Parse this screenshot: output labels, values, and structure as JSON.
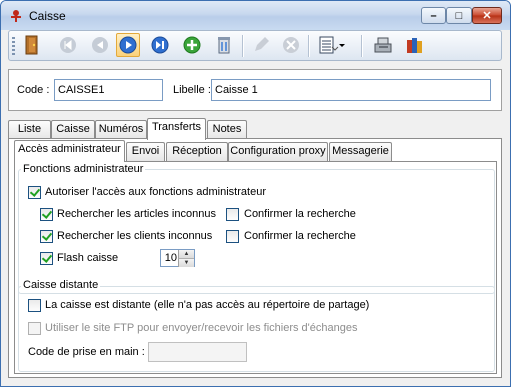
{
  "window": {
    "title": "Caisse"
  },
  "caption_buttons": {
    "minimize": "–",
    "maximize": "□",
    "close": "✕"
  },
  "toolbar": {
    "items": [
      {
        "name": "exit-icon",
        "enabled": true
      },
      {
        "name": "first-record-icon",
        "enabled": false
      },
      {
        "name": "previous-record-icon",
        "enabled": false
      },
      {
        "name": "next-record-icon",
        "enabled": true,
        "active": true
      },
      {
        "name": "last-record-icon",
        "enabled": true
      },
      {
        "name": "add-icon",
        "enabled": true
      },
      {
        "name": "delete-icon",
        "enabled": true
      },
      {
        "name": "edit-icon",
        "enabled": false
      },
      {
        "name": "cancel-icon",
        "enabled": false
      },
      {
        "name": "list-menu-icon",
        "enabled": true
      },
      {
        "name": "cash-register-icon",
        "enabled": true
      },
      {
        "name": "books-icon",
        "enabled": true
      }
    ]
  },
  "header": {
    "code_label": "Code :",
    "code_value": "CAISSE1",
    "libelle_label": "Libelle :",
    "libelle_value": "Caisse 1"
  },
  "main_tabs": [
    "Liste",
    "Caisse",
    "Numéros",
    "Transferts",
    "Notes"
  ],
  "main_tab_selected": "Transferts",
  "sub_tabs": [
    "Accès administrateur",
    "Envoi",
    "Réception",
    "Configuration proxy",
    "Messagerie"
  ],
  "sub_tab_selected": "Accès administrateur",
  "fonctions_admin": {
    "title": "Fonctions administrateur",
    "autoriser": {
      "label": "Autoriser l'accès aux fonctions administrateur",
      "checked": true
    },
    "rech_articles": {
      "label": "Rechercher les articles inconnus",
      "checked": true
    },
    "confirm_articles": {
      "label": "Confirmer la recherche",
      "checked": false
    },
    "rech_clients": {
      "label": "Rechercher les clients inconnus",
      "checked": true
    },
    "confirm_clients": {
      "label": "Confirmer la recherche",
      "checked": false
    },
    "flash": {
      "label": "Flash caisse",
      "checked": true,
      "value": "10"
    }
  },
  "caisse_distante": {
    "title": "Caisse distante",
    "distante": {
      "label": "La caisse est distante (elle n'a pas accès au répertoire de partage)",
      "checked": false
    },
    "ftp": {
      "label": "Utiliser le site FTP pour envoyer/recevoir les fichiers d'échanges",
      "checked": false,
      "disabled": true
    },
    "code_prise_label": "Code de prise en main :",
    "code_prise_value": ""
  }
}
